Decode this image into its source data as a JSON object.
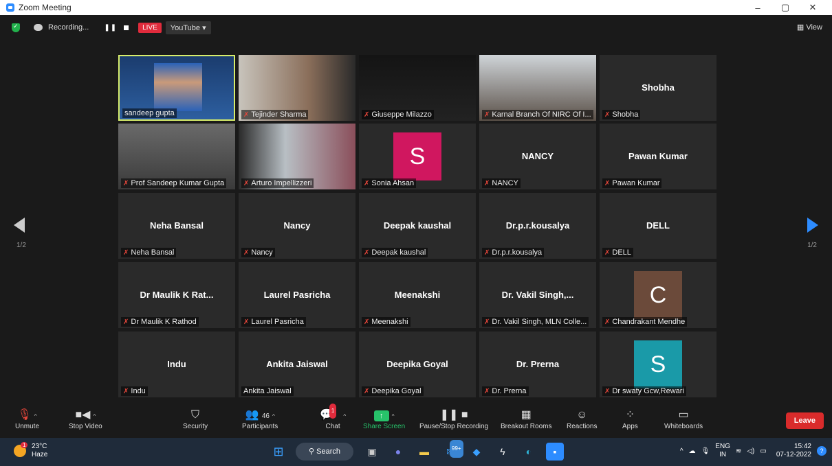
{
  "window": {
    "title": "Zoom Meeting",
    "controls": [
      "–",
      "▢",
      "✕"
    ]
  },
  "topbar": {
    "recording": "Recording...",
    "live": "LIVE",
    "youtube": "YouTube",
    "view": "View"
  },
  "pager": {
    "left": "1/2",
    "right": "1/2"
  },
  "tiles": [
    {
      "name": "sandeep gupta",
      "label": "sandeep gupta",
      "muted": false,
      "active": true,
      "video": true
    },
    {
      "name": "Tejinder Sharma",
      "label": "Tejinder Sharma",
      "muted": true,
      "video": true
    },
    {
      "name": "Giuseppe Milazzo",
      "label": "Giuseppe Milazzo",
      "muted": true,
      "video": true
    },
    {
      "name": "Karnal Branch Of NIRC Of I...",
      "label": "Karnal Branch Of NIRC Of I...",
      "muted": true,
      "video": true
    },
    {
      "name": "Shobha",
      "label": "Shobha",
      "muted": true
    },
    {
      "name": "Prof Sandeep Kumar Gupta",
      "label": "Prof Sandeep Kumar Gupta",
      "muted": true,
      "video": true
    },
    {
      "name": "Arturo Impellizzeri",
      "label": "Arturo Impellizzeri",
      "muted": true,
      "video": true
    },
    {
      "name": "Sonia Ahsan",
      "label": "Sonia Ahsan",
      "muted": true,
      "avatar": "S",
      "avatar_color": "#d0175f"
    },
    {
      "name": "NANCY",
      "label": "NANCY",
      "muted": true
    },
    {
      "name": "Pawan Kumar",
      "label": "Pawan Kumar",
      "muted": true
    },
    {
      "name": "Neha Bansal",
      "label": "Neha Bansal",
      "muted": true
    },
    {
      "name": "Nancy",
      "label": "Nancy",
      "muted": true
    },
    {
      "name": "Deepak kaushal",
      "label": "Deepak kaushal",
      "muted": true
    },
    {
      "name": "Dr.p.r.kousalya",
      "label": "Dr.p.r.kousalya",
      "muted": true
    },
    {
      "name": "DELL",
      "label": "DELL",
      "muted": true
    },
    {
      "name": "Dr Maulik K Rat...",
      "label": "Dr Maulik K Rathod",
      "muted": true
    },
    {
      "name": "Laurel Pasricha",
      "label": "Laurel Pasricha",
      "muted": true
    },
    {
      "name": "Meenakshi",
      "label": "Meenakshi",
      "muted": true
    },
    {
      "name": "Dr. Vakil Singh,...",
      "label": "Dr. Vakil Singh, MLN Colle...",
      "muted": true
    },
    {
      "name": "Chandrakant Mendhe",
      "label": "Chandrakant Mendhe",
      "muted": true,
      "avatar": "C",
      "avatar_color": "#6b4a3a"
    },
    {
      "name": "Indu",
      "label": "Indu",
      "muted": true
    },
    {
      "name": "Ankita Jaiswal",
      "label": "Ankita Jaiswal",
      "muted": false
    },
    {
      "name": "Deepika Goyal",
      "label": "Deepika Goyal",
      "muted": true
    },
    {
      "name": "Dr. Prerna",
      "label": "Dr. Prerna",
      "muted": true
    },
    {
      "name": "Dr swaty Gcw,Rewari",
      "label": "Dr swaty Gcw,Rewari",
      "muted": true,
      "avatar": "S",
      "avatar_color": "#1a9aa8"
    }
  ],
  "toolbar": {
    "unmute": "Unmute",
    "stop_video": "Stop Video",
    "security": "Security",
    "participants": "Participants",
    "participants_count": "46",
    "chat": "Chat",
    "chat_badge": "1",
    "share_screen": "Share Screen",
    "pause_recording": "Pause/Stop Recording",
    "breakout": "Breakout Rooms",
    "reactions": "Reactions",
    "apps": "Apps",
    "whiteboards": "Whiteboards",
    "leave": "Leave"
  },
  "taskbar": {
    "temp": "23°C",
    "weather": "Haze",
    "weather_badge": "1",
    "search": "Search",
    "mail_badge": "99+",
    "lang": "ENG",
    "region": "IN",
    "time": "15:42",
    "date": "07-12-2022"
  },
  "colors": {
    "accent": "#2D8CFF",
    "live": "#e02b3c",
    "share": "#27c26a",
    "leave": "#d92b2b",
    "active_border": "#d8ee6b"
  }
}
